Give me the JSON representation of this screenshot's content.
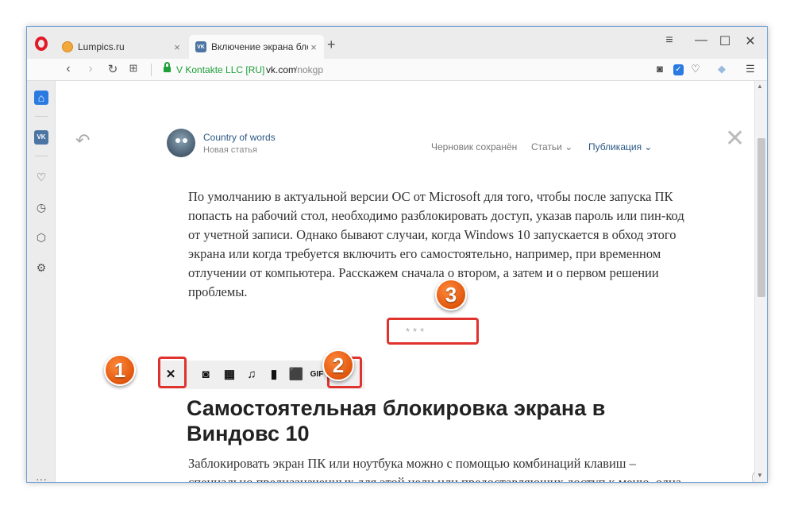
{
  "browser": {
    "tabs": [
      {
        "title": "Lumpics.ru",
        "close": "×"
      },
      {
        "title": "Включение экрана блоки",
        "favicon_text": "VK",
        "close": "×"
      }
    ],
    "new_tab_label": "+",
    "address": {
      "certificate": "V Kontakte LLC [RU]",
      "host": "vk.com",
      "path": "/nokgp"
    }
  },
  "editor": {
    "author": "Country of words",
    "subtitle": "Новая статья",
    "draft_status": "Черновик сохранён",
    "menu": {
      "articles": "Статьи ⌄",
      "publish": "Публикация ⌄"
    },
    "paragraph_1": "По умолчанию в актуальной версии ОС от Microsoft для того, чтобы после запуска ПК попасть на рабочий стол, необходимо разблокировать доступ, указав пароль или пин-код от учетной записи. Однако бывают случаи, когда Windows 10 запускается в обход этого экрана или когда требуется включить его самостоятельно, например, при временном отлучении от компьютера. Расскажем сначала о втором, а затем и о первом решении проблемы.",
    "separator": "***",
    "heading": "Самостоятельная блокировка экрана в Виндовс 10",
    "paragraph_2": "Заблокировать экран ПК или ноутбука можно с помощью комбинаций клавиш – специально предназначенных для этой цели или предоставляющих доступ к меню, одна из опций которого решает нашу задачу.",
    "toolbar": {
      "gif_label": "GIF"
    }
  },
  "callouts": [
    "1",
    "2",
    "3"
  ],
  "colors": {
    "accent": "#2a7ae2",
    "highlight": "#e0332e",
    "callout": "#e35a10",
    "secure": "#1c9f37"
  }
}
